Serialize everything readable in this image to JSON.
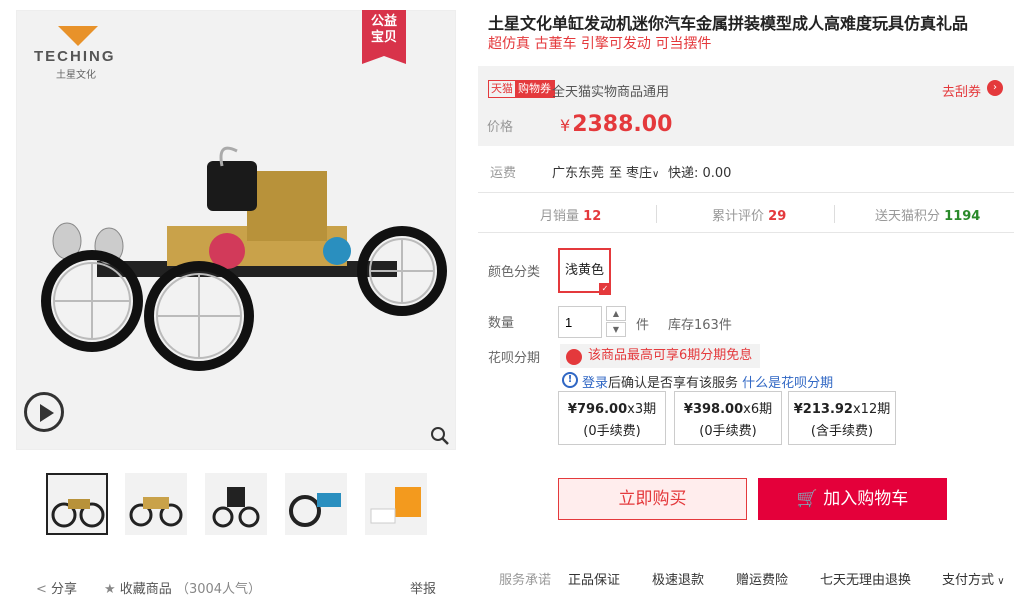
{
  "gallery": {
    "logo_text": "TECHING",
    "logo_sub": "土星文化",
    "badge_line1": "公益",
    "badge_line2": "宝贝",
    "thumb_count": 5
  },
  "actions": {
    "share": "分享",
    "favorite": "收藏商品",
    "popularity": "（3004人气）",
    "report": "举报"
  },
  "product": {
    "title": "土星文化单缸发动机迷你汽车金属拼装模型成人高难度玩具仿真礼品",
    "subtitle": "超仿真 古董车 引擎可发动 可当摆件"
  },
  "coupon": {
    "tag_left": "天猫",
    "tag_right": "购物券",
    "desc": "全天猫实物商品通用",
    "link": "去刮券",
    "arrow": "›"
  },
  "price": {
    "label": "价格",
    "currency": "¥",
    "value": "2388.00"
  },
  "shipping": {
    "label": "运费",
    "from": "广东东莞",
    "to_word": "至",
    "to": "枣庄",
    "express": "快递: 0.00"
  },
  "stats": [
    {
      "label": "月销量",
      "value": "12"
    },
    {
      "label": "累计评价",
      "value": "29"
    },
    {
      "label": "送天猫积分",
      "value": "1194"
    }
  ],
  "options": {
    "color_label": "颜色分类",
    "color_value": "浅黄色",
    "qty_label": "数量",
    "qty_value": "1",
    "qty_unit": "件",
    "stock": "库存163件"
  },
  "huabei": {
    "label": "花呗分期",
    "banner": "该商品最高可享6期分期免息",
    "info_login": "登录",
    "info_text": "后确认是否享有该服务",
    "info_link": "什么是花呗分期",
    "installments": [
      {
        "amount": "¥796.00",
        "period": "x3期",
        "fee": "(0手续费)"
      },
      {
        "amount": "¥398.00",
        "period": "x6期",
        "fee": "(0手续费)"
      },
      {
        "amount": "¥213.92",
        "period": "x12期",
        "fee": "(含手续费)"
      }
    ]
  },
  "buttons": {
    "buy_now": "立即购买",
    "add_cart": "加入购物车"
  },
  "services": {
    "label": "服务承诺",
    "items": [
      "正品保证",
      "极速退款",
      "赠运费险",
      "七天无理由退换"
    ],
    "pay": "支付方式"
  },
  "colors": {
    "accent": "#e4393c",
    "cart": "#e4003a",
    "link": "#3067c4"
  }
}
